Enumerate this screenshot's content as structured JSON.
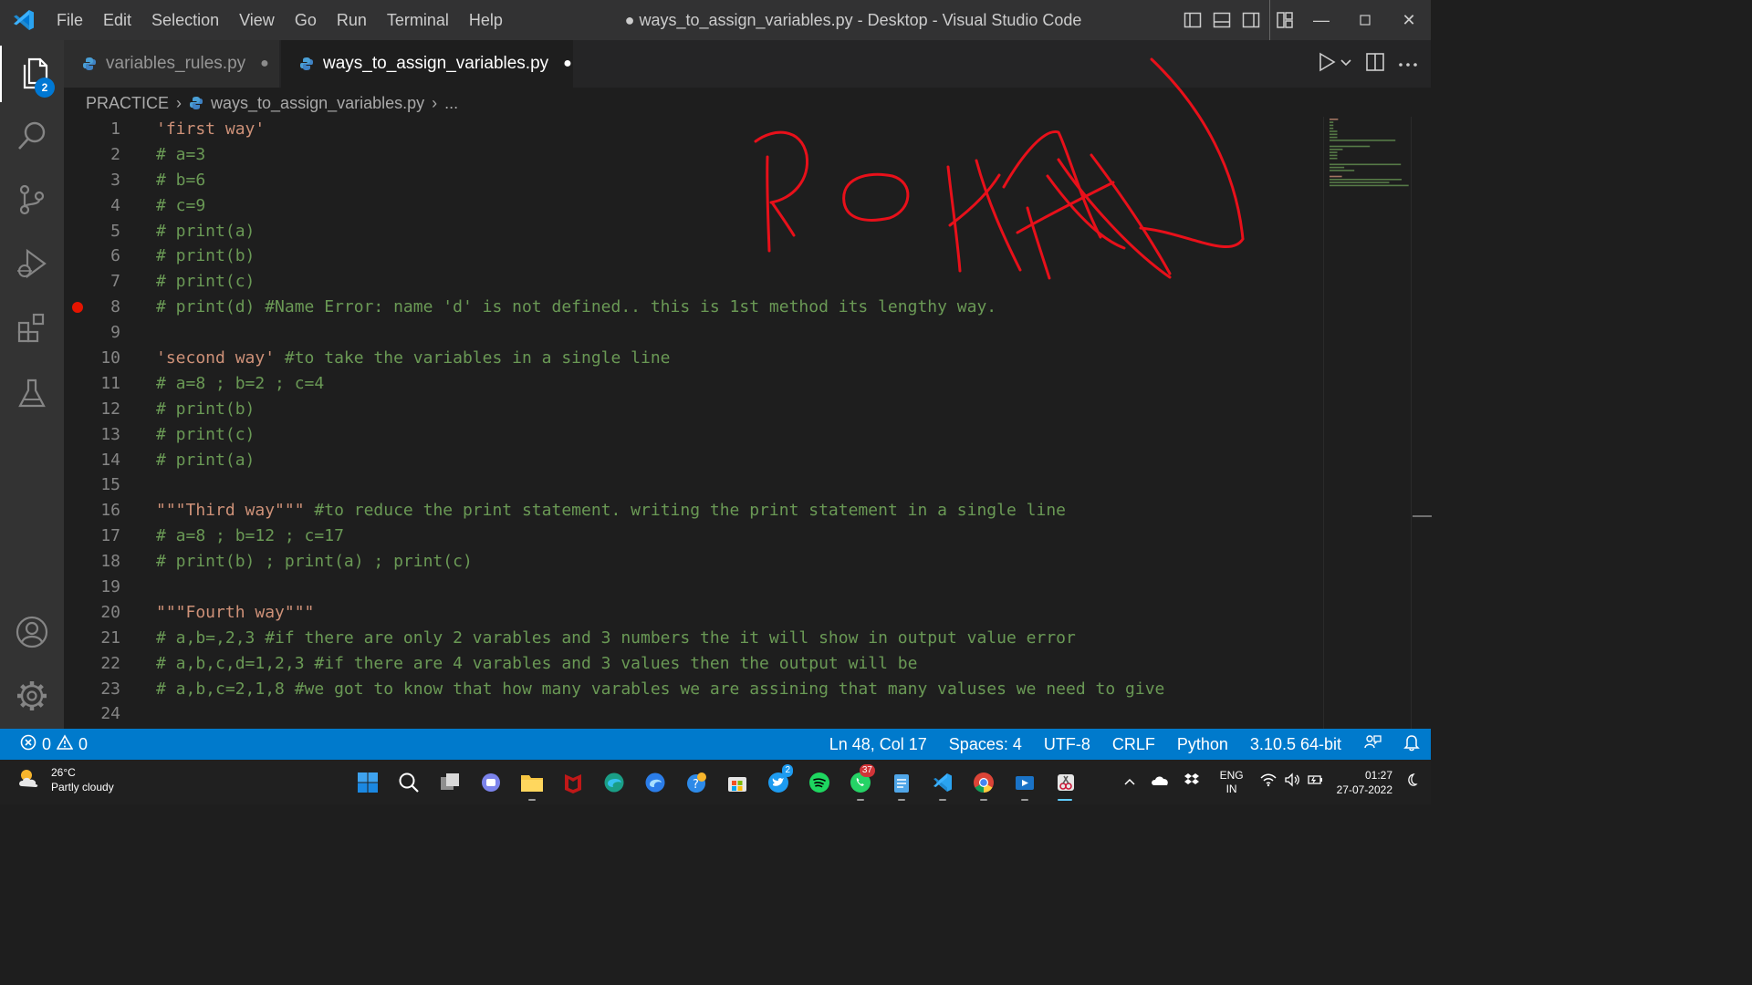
{
  "window": {
    "title": "● ways_to_assign_variables.py - Desktop - Visual Studio Code",
    "menu": [
      "File",
      "Edit",
      "Selection",
      "View",
      "Go",
      "Run",
      "Terminal",
      "Help"
    ]
  },
  "activity_bar": {
    "explorer_badge": "2",
    "items": [
      "explorer-icon",
      "search-icon",
      "source-control-icon",
      "run-debug-icon",
      "extensions-icon",
      "testing-icon",
      "accounts-icon",
      "settings-gear-icon"
    ]
  },
  "tabs": [
    {
      "label": "variables_rules.py",
      "modified": true,
      "active": false
    },
    {
      "label": "ways_to_assign_variables.py",
      "modified": true,
      "active": true
    }
  ],
  "breadcrumb": {
    "folder": "PRACTICE",
    "file": "ways_to_assign_variables.py",
    "symbol": "..."
  },
  "editor": {
    "breakpoint_line": 8,
    "lines": [
      {
        "n": "1",
        "text": "'first way'",
        "kind": "string"
      },
      {
        "n": "2",
        "text": "# a=3",
        "kind": "comment"
      },
      {
        "n": "3",
        "text": "# b=6",
        "kind": "comment"
      },
      {
        "n": "4",
        "text": "# c=9",
        "kind": "comment"
      },
      {
        "n": "5",
        "text": "# print(a)",
        "kind": "comment"
      },
      {
        "n": "6",
        "text": "# print(b)",
        "kind": "comment"
      },
      {
        "n": "7",
        "text": "# print(c)",
        "kind": "comment"
      },
      {
        "n": "8",
        "text": "# print(d) #Name Error: name 'd' is not defined.. this is 1st method its lengthy way.",
        "kind": "comment"
      },
      {
        "n": "9",
        "text": "",
        "kind": "blank"
      },
      {
        "n": "10",
        "str": "'second way'",
        "comment": " #to take the variables in a single line",
        "kind": "mixed"
      },
      {
        "n": "11",
        "text": "# a=8 ; b=2 ; c=4",
        "kind": "comment"
      },
      {
        "n": "12",
        "text": "# print(b)",
        "kind": "comment"
      },
      {
        "n": "13",
        "text": "# print(c)",
        "kind": "comment"
      },
      {
        "n": "14",
        "text": "# print(a)",
        "kind": "comment"
      },
      {
        "n": "15",
        "text": "",
        "kind": "blank"
      },
      {
        "n": "16",
        "str": "\"\"\"Third way\"\"\"",
        "comment": " #to reduce the print statement. writing the print statement in a single line",
        "kind": "mixed"
      },
      {
        "n": "17",
        "text": "# a=8 ; b=12 ; c=17",
        "kind": "comment"
      },
      {
        "n": "18",
        "text": "# print(b) ; print(a) ; print(c)",
        "kind": "comment"
      },
      {
        "n": "19",
        "text": "",
        "kind": "blank"
      },
      {
        "n": "20",
        "text": "\"\"\"Fourth way\"\"\"",
        "kind": "string"
      },
      {
        "n": "21",
        "text": "# a,b=,2,3 #if there are only 2 varables and 3 numbers the it will show in output value error",
        "kind": "comment"
      },
      {
        "n": "22",
        "text": "# a,b,c,d=1,2,3 #if there are 4 varables and 3 values then the output will be",
        "kind": "comment"
      },
      {
        "n": "23",
        "text": "# a,b,c=2,1,8 #we got to know that how many varables we are assining that many valuses we need to give",
        "kind": "comment"
      },
      {
        "n": "24",
        "text": "",
        "kind": "blank"
      }
    ]
  },
  "status_bar": {
    "errors": "0",
    "warnings": "0",
    "position": "Ln 48, Col 17",
    "spaces": "Spaces: 4",
    "encoding": "UTF-8",
    "eol": "CRLF",
    "language": "Python",
    "interpreter": "3.10.5 64-bit"
  },
  "taskbar": {
    "weather_temp": "26°C",
    "weather_desc": "Partly cloudy",
    "twitter_badge": "2",
    "whatsapp_badge": "37",
    "lang_1": "ENG",
    "lang_2": "IN",
    "time": "01:27",
    "date": "27-07-2022"
  },
  "annotation": {
    "handwritten_text": "ROHAN"
  },
  "colors": {
    "accent": "#007acc",
    "comment": "#6a9955",
    "string": "#ce9178",
    "annotation": "#e8101a",
    "breakpoint": "#e51400"
  }
}
